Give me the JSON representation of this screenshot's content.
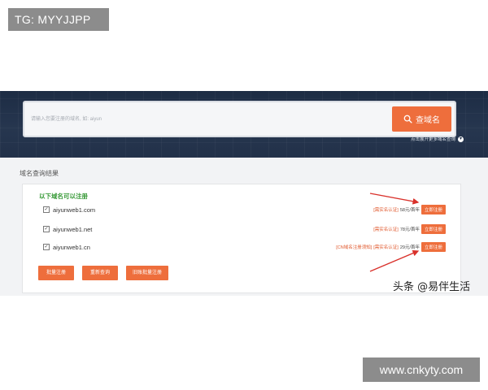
{
  "top_badge": {
    "text": "TG: MYYJJPP"
  },
  "search": {
    "placeholder": "请输入您要注册的域名, 如: aiyun",
    "button_label": "查域名",
    "expand_label": "点击展开更多域名查询"
  },
  "results": {
    "title": "域名查询结果",
    "heading": "以下域名可以注册",
    "rows": [
      {
        "domain": "aiyunweb1.com",
        "checked": true,
        "notes": [],
        "tag": "[需实名认证]",
        "price": "58元/首年",
        "button": "立即注册"
      },
      {
        "domain": "aiyunweb1.net",
        "checked": true,
        "notes": [],
        "tag": "[需实名认证]",
        "price": "78元/首年",
        "button": "立即注册"
      },
      {
        "domain": "aiyunweb1.cn",
        "checked": true,
        "notes": [
          "[CN域名注册须知]"
        ],
        "tag": "[需实名认证]",
        "price": "29元/首年",
        "button": "立即注册"
      }
    ],
    "actions": {
      "batch_register": "批量注册",
      "requery": "重新查询",
      "batch_register_all": "旧账批量注册"
    }
  },
  "watermark": {
    "text": "头条 @易伴生活"
  },
  "bottom_badge": {
    "text": "www.cnkyty.com"
  },
  "colors": {
    "accent": "#ee6e3c",
    "hero_bg": "#223149",
    "heading_green": "#3a9b3a",
    "arrow_red": "#d9312b"
  }
}
